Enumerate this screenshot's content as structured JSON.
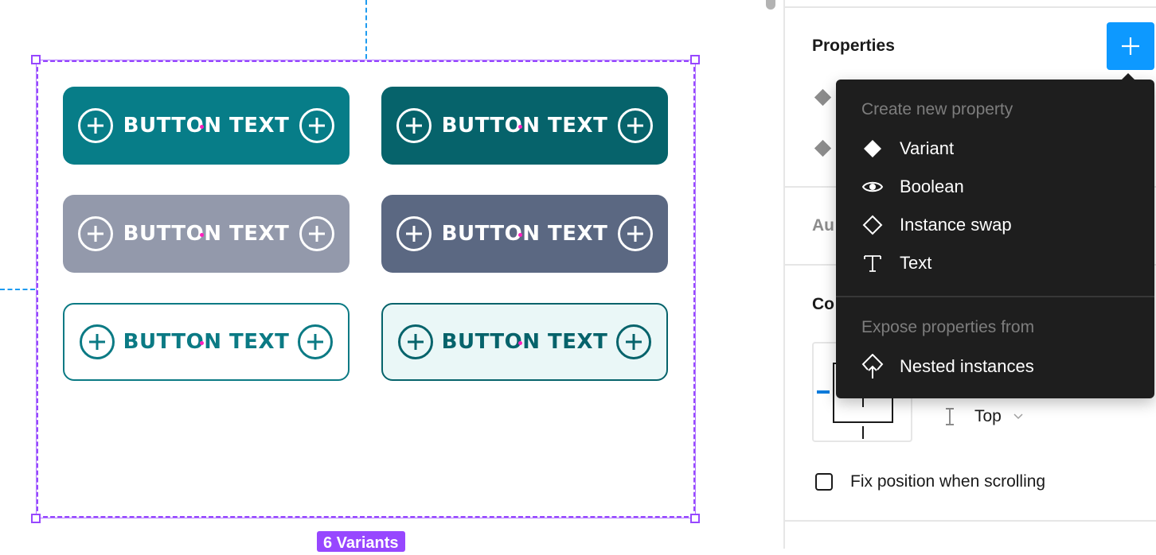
{
  "canvas": {
    "variant_count_badge": "6 Variants",
    "buttons": [
      {
        "label": "BUTTON TEXT",
        "style": "primary",
        "bg": "#077d88",
        "fg": "#ffffff"
      },
      {
        "label": "BUTTON TEXT",
        "style": "primary-dark",
        "bg": "#06636b",
        "fg": "#ffffff"
      },
      {
        "label": "BUTTON TEXT",
        "style": "secondary",
        "bg": "#9399ab",
        "fg": "#ffffff"
      },
      {
        "label": "BUTTON TEXT",
        "style": "secondary-dark",
        "bg": "#5b6882",
        "fg": "#ffffff"
      },
      {
        "label": "BUTTON TEXT",
        "style": "outline",
        "bg": "#ffffff",
        "fg": "#0b7a84"
      },
      {
        "label": "BUTTON TEXT",
        "style": "outline-tinted",
        "bg": "#eaf7f7",
        "fg": "#06636b"
      }
    ],
    "selection_color": "#9747ff",
    "guide_color": "#1e9bf0"
  },
  "panel": {
    "properties_title": "Properties",
    "add_property_icon": "plus-icon",
    "auto_layout_label_partial": "Au",
    "constraints_label_partial": "Co",
    "vertical_constraint": "Top",
    "fix_position_label": "Fix position when scrolling",
    "fix_position_checked": false,
    "accent": "#0d99ff"
  },
  "menu": {
    "create_header": "Create new property",
    "items": [
      {
        "label": "Variant",
        "icon": "diamond-filled-icon"
      },
      {
        "label": "Boolean",
        "icon": "eye-icon"
      },
      {
        "label": "Instance swap",
        "icon": "diamond-outline-icon"
      },
      {
        "label": "Text",
        "icon": "text-icon"
      }
    ],
    "expose_header": "Expose properties from",
    "expose_items": [
      {
        "label": "Nested instances",
        "icon": "nested-instances-icon"
      }
    ]
  }
}
